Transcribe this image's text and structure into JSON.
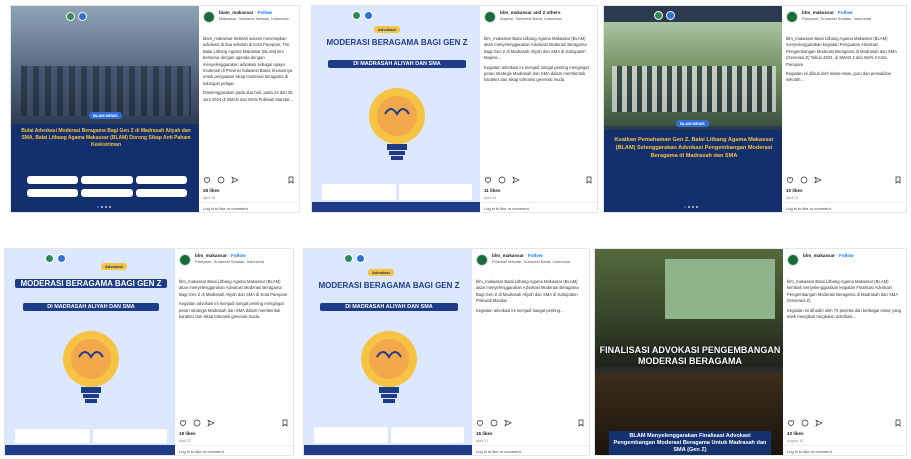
{
  "posts": [
    {
      "account": "blam_makassar",
      "follow": "Follow",
      "location": "Makassar, Sulawesi Selatan, Indonesia",
      "caption": [
        "blam_makassar Setelah sukses menerapkan advokasi di dua sekolah di Kota Parepare, Tim Balai Litbang Agama Makassar (BLAM) kini bersama dengan agenda dengan menyelenggarakan advokasi sebagai upaya moderasi di Provinsi Sulawesi Barat, khususnya untuk penguatan sikap moderasi beragama di kalangan pelajar.",
        "Diselenggarakan pada dua hari, pada 24 dan 25 Juni 2024 di SMAN dan MAN Polewali Mandar..."
      ],
      "banner_badge": "BLAM NEWS",
      "banner_title": "Bulai Advokasi Moderasi Beragama Bagi Gen Z di Madrasah Aliyah dan SMA, Balai Litbang Agama Makassar (BLAM) Dorong Sikap Anti Paham Keekstriman",
      "likes": "28 likes",
      "date": "April 26",
      "login": "Log in to like or comment."
    },
    {
      "account": "blm_makassar and 2 others",
      "follow": "",
      "location": "Majene, Sulawesi Barat, Indonesia",
      "caption": [
        "blm_makassar Balai Litbang Agama Makassar (BLAM) akan menyelenggarakan Advokasi Moderasi Beragama Bagi Gen Z di Madrasah Aliyah dan SMA di Kabupaten Majene...",
        "Kegiatan advokasi ini menjadi sangat penting mengingat peran strategis Madrasah dan SMA dalam membentuk karakter dan sikap toleransi generasi muda."
      ],
      "tag": "Advokasi",
      "banner_title": "MODERASI BERAGAMA BAGI GEN Z",
      "banner_sub": "DI MADRASAH ALIYAH DAN SMA",
      "likes": "11 likes",
      "date": "April 24",
      "login": "Log in to like or comment."
    },
    {
      "account": "blm_makassar",
      "follow": "Follow",
      "location": "Parepare, Sulawesi Selatan, Indonesia",
      "caption": [
        "blm_makassar Balai Litbang Agama Makassar (BLAM) menyelenggarakan kegiatan Penguatan Advokasi Pengembangan Moderasi Beragama di Madrasah dan SMA (Generasi Z) Tahun 2024, di SMAN 2 dan MAN 2 Kota Parepare.",
        "Kegiatan ini diikuti oleh siswa-siswi, guru dan perwakilan sekolah..."
      ],
      "banner_badge": "BLAM NEWS",
      "banner_title": "Kuatkan Pemahaman Gen Z, Balai Litbang Agama Makassar (BLAM) Selenggarakan Advokasi Pengembangan Moderasi Beragama di Madrasah dan SMA",
      "likes": "10 likes",
      "date": "April 23",
      "login": "Log in to like or comment."
    },
    {
      "account": "blm_makassar",
      "follow": "Follow",
      "location": "Parepare, Sulawesi Selatan, Indonesia",
      "caption": [
        "blm_makassar Balai Litbang Agama Makassar (BLAM) akan menyelenggarakan Advokasi Moderasi Beragama Bagi Gen Z di Madrasah Aliyah dan SMA di Kota Parepare.",
        "Kegiatan advokasi ini menjadi sangat penting mengingat peran strategis Madrasah dan SMA dalam membentuk karakter dan sikap toleransi generasi muda."
      ],
      "tag": "Advokasi",
      "banner_title": "MODERASI BERAGAMA BAGI GEN Z",
      "banner_sub": "DI MADRASAH ALIYAH DAN SMA",
      "likes": "18 likes",
      "date": "April 22",
      "login": "Log in to like or comment."
    },
    {
      "account": "blm_makassar",
      "follow": "Follow",
      "location": "Polewali Mandar, Sulawesi Barat, Indonesia",
      "caption": [
        "blm_makassar Balai Litbang Agama Makassar (BLAM) akan menyelenggarakan Advokasi Moderasi Beragama Bagi Gen Z di Madrasah Aliyah dan SMA di Kabupaten Polewali Mandar.",
        "Kegiatan advokasi ini menjadi sangat penting..."
      ],
      "tag": "Advokasi",
      "banner_title": "MODERASI BERAGAMA BAGI GEN Z",
      "banner_sub": "DI MADRASAH ALIYAH DAN SMA",
      "likes": "15 likes",
      "date": "April 21",
      "login": "Log in to like or comment."
    },
    {
      "account": "blm_makassar",
      "follow": "Follow",
      "location": "",
      "caption": [
        "blm_makassar Balai Litbang Agama Makassar (BLAM) kembali menyelenggarakan kegiatan Finalisasi Advokasi Pengembangan Moderasi Beragama di Madrasah dan SMA (Generasi Z).",
        "Kegiatan ini dihadiri oleh 70 peserta dari berbagai unsur yang telah mengikuti rangkaian advokasi..."
      ],
      "banner_title": "FINALISASI ADVOKASI PENGEMBANGAN MODERASI BERAGAMA",
      "banner_sub": "BLAM Menyelenggarakan Finalisasi Advokasi Pengembangan Moderasi Beragama Untuk Madrasah dan SMA (Gen Z)",
      "likes": "43 likes",
      "date": "August 15",
      "login": "Log in to like or comment."
    }
  ],
  "colors": {
    "navy": "#1f3c88",
    "deep_blue": "#14326e",
    "sky": "#dbe8ff",
    "accent_yellow": "#f6c343",
    "green": "#1a6b3c"
  }
}
